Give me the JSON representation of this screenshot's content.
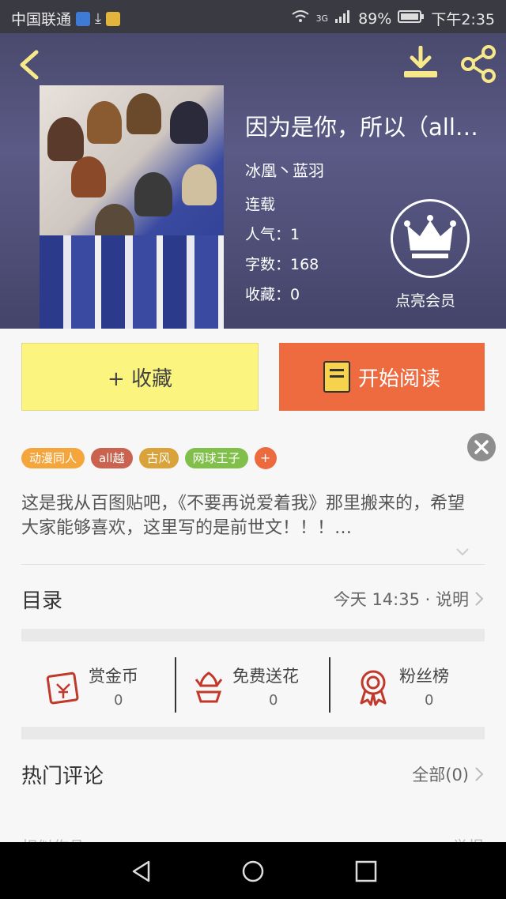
{
  "status_bar": {
    "carrier": "中国联通",
    "network": "3G",
    "battery": "89%",
    "time": "下午2:35"
  },
  "book": {
    "title": "因为是你，所以（all…",
    "author": "冰凰丶蓝羽",
    "status": "连载",
    "popularity": "人气：1",
    "word_count": "字数：168",
    "favorites": "收藏：0"
  },
  "vip": {
    "label": "点亮会员"
  },
  "actions": {
    "favorite_label": "+ 收藏",
    "read_label": "开始阅读"
  },
  "tags": [
    {
      "label": "动漫同人",
      "color": "#f4a53c"
    },
    {
      "label": "all越",
      "color": "#c9634f"
    },
    {
      "label": "古风",
      "color": "#d9a23a"
    },
    {
      "label": "网球王子",
      "color": "#7fbf4a"
    }
  ],
  "tag_add": "+",
  "description": "这是我从百图贴吧，《不要再说爱着我》那里搬来的，希望大家能够喜欢，这里写的是前世文！！！…",
  "catalog": {
    "title": "目录",
    "update": "今天 14:35 · 说明"
  },
  "stats": [
    {
      "label": "赏金币",
      "value": "0"
    },
    {
      "label": "免费送花",
      "value": "0"
    },
    {
      "label": "粉丝榜",
      "value": "0"
    }
  ],
  "comments": {
    "title": "热门评论",
    "all": "全部(0)"
  },
  "bottom_cut": {
    "left": "相似作品",
    "right": "举报"
  },
  "colors": {
    "accent": "#ee6a3f",
    "favorite_bg": "#fbf47f",
    "header_bg": "#4a4a6e",
    "icon_red": "#c0392b"
  }
}
